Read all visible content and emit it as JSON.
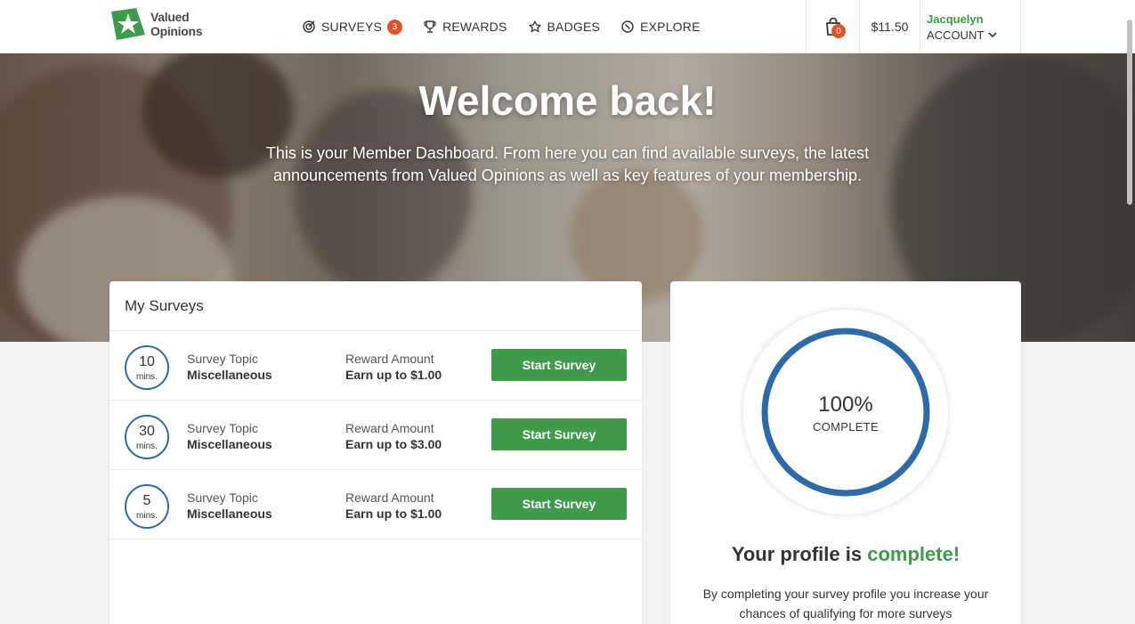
{
  "header": {
    "logo": {
      "line1": "Valued",
      "line2": "Opinions"
    },
    "nav": [
      {
        "label": "SURVEYS",
        "icon": "target-icon",
        "badge": "3"
      },
      {
        "label": "REWARDS",
        "icon": "trophy-icon"
      },
      {
        "label": "BADGES",
        "icon": "star-icon"
      },
      {
        "label": "EXPLORE",
        "icon": "compass-icon"
      }
    ],
    "cart_count": "0",
    "balance": "$11.50",
    "user_name": "Jacquelyn",
    "account_label": "ACCOUNT"
  },
  "hero": {
    "title": "Welcome back!",
    "subtitle": "This is your Member Dashboard. From here you can find available surveys, the latest announcements from Valued Opinions as well as key features of your membership."
  },
  "surveys": {
    "title": "My Surveys",
    "rows": [
      {
        "minutes": "10",
        "unit": "mins.",
        "topic_label": "Survey Topic",
        "topic": "Miscellaneous",
        "reward_label": "Reward Amount",
        "reward": "Earn up to $1.00",
        "button": "Start Survey"
      },
      {
        "minutes": "30",
        "unit": "mins.",
        "topic_label": "Survey Topic",
        "topic": "Miscellaneous",
        "reward_label": "Reward Amount",
        "reward": "Earn up to $3.00",
        "button": "Start Survey"
      },
      {
        "minutes": "5",
        "unit": "mins.",
        "topic_label": "Survey Topic",
        "topic": "Miscellaneous",
        "reward_label": "Reward Amount",
        "reward": "Earn up to $1.00",
        "button": "Start Survey"
      }
    ]
  },
  "profile": {
    "percent": "100%",
    "percent_label": "COMPLETE",
    "progress": 1.0,
    "title_prefix": "Your profile is",
    "title_status": "complete!",
    "text": "By completing your survey profile you increase your chances of qualifying for more surveys"
  },
  "colors": {
    "brand_green": "#3f9a4c",
    "ring_blue": "#2f6aa8",
    "badge_orange": "#e0522c"
  }
}
